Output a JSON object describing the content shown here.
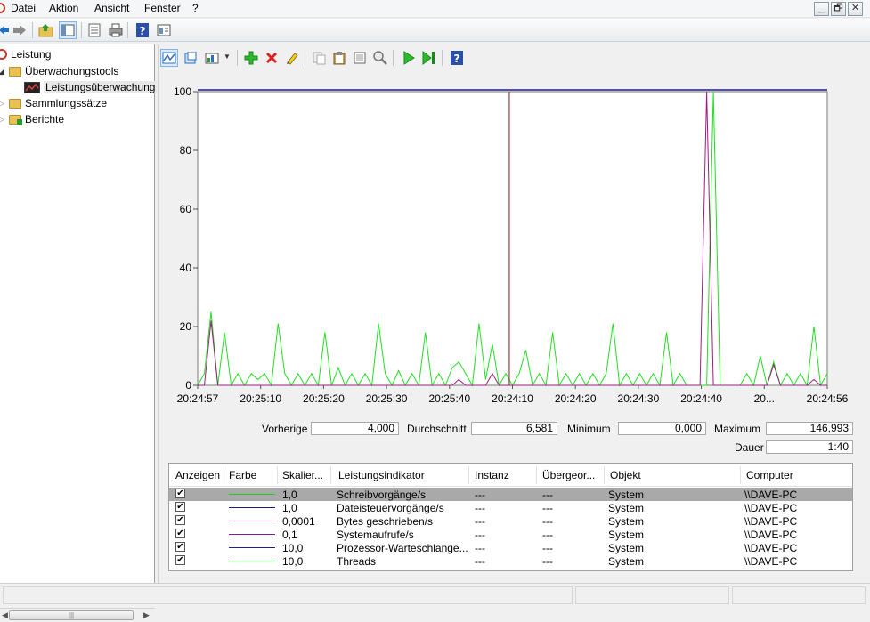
{
  "menu": [
    "Datei",
    "Aktion",
    "Ansicht",
    "Fenster",
    "?"
  ],
  "window_buttons": {
    "minimize": "_",
    "restore": "🗗",
    "close": "✕"
  },
  "tree": {
    "items": [
      {
        "label": "Leistung"
      },
      {
        "label": "Überwachungstools"
      },
      {
        "label": "Leistungsüberwachung"
      },
      {
        "label": "Sammlungssätze"
      },
      {
        "label": "Berichte"
      }
    ],
    "scroll_thumb": "|||"
  },
  "chart_data": {
    "type": "line",
    "ylim": [
      0,
      100
    ],
    "y_ticks": [
      "100",
      "80",
      "60",
      "40",
      "20",
      "0"
    ],
    "x_ticks": [
      "20:24:57",
      "20:25:10",
      "20:25:20",
      "20:25:30",
      "20:25:40",
      "20:24:10",
      "20:24:20",
      "20:24:30",
      "20:24:40",
      "20...",
      "20:24:56"
    ],
    "series": [
      {
        "name": "Schreibvorgänge/s",
        "color": "#22dd22",
        "values": [
          0,
          4,
          25,
          0,
          18,
          0,
          4,
          0,
          4,
          2,
          4,
          0,
          21,
          4,
          0,
          4,
          0,
          4,
          0,
          18,
          0,
          6,
          0,
          4,
          0,
          4,
          0,
          21,
          4,
          0,
          5,
          0,
          4,
          0,
          18,
          0,
          4,
          0,
          6,
          8,
          4,
          0,
          21,
          2,
          14,
          0,
          4,
          0,
          4,
          12,
          0,
          4,
          0,
          18,
          0,
          4,
          0,
          4,
          0,
          4,
          0,
          4,
          21,
          0,
          4,
          0,
          4,
          0,
          4,
          0,
          18,
          0,
          4,
          0,
          0,
          0,
          0,
          100,
          0,
          0,
          0,
          0,
          4,
          0,
          10,
          0,
          8,
          0,
          4,
          0,
          4,
          0,
          20,
          0,
          4
        ]
      },
      {
        "name": "Systemaufrufe/s",
        "color": "#9b1e7c",
        "values": [
          0,
          0,
          22,
          0,
          0,
          0,
          0,
          0,
          0,
          0,
          0,
          0,
          0,
          0,
          0,
          0,
          0,
          0,
          0,
          0,
          0,
          0,
          0,
          0,
          0,
          0,
          0,
          0,
          0,
          0,
          0,
          0,
          0,
          0,
          0,
          0,
          0,
          0,
          0,
          2,
          0,
          0,
          0,
          0,
          4,
          0,
          0,
          0,
          0,
          0,
          0,
          0,
          0,
          0,
          0,
          0,
          0,
          0,
          0,
          0,
          0,
          0,
          0,
          0,
          0,
          0,
          0,
          0,
          0,
          0,
          0,
          0,
          0,
          0,
          0,
          0,
          100,
          0,
          0,
          0,
          0,
          0,
          0,
          0,
          0,
          0,
          7,
          0,
          0,
          0,
          0,
          0,
          2,
          0,
          0
        ]
      },
      {
        "name": "Prozessor-Warteschlange",
        "color": "#1e1e8c",
        "values": [
          101,
          101,
          101,
          101,
          101,
          101,
          101,
          101,
          101,
          101,
          101,
          101,
          101,
          101,
          101,
          101,
          101,
          101,
          101,
          101,
          101,
          101,
          101,
          101,
          101,
          101,
          101,
          101,
          101,
          101,
          101,
          101,
          101,
          101,
          101,
          101,
          101,
          101,
          101,
          101,
          101,
          101,
          101,
          101,
          101,
          101,
          101,
          101,
          101,
          101,
          101,
          101,
          101,
          101,
          101,
          101,
          101,
          101,
          101,
          101,
          101,
          101,
          101,
          101,
          101,
          101,
          101,
          101,
          101,
          101,
          101,
          101,
          101,
          101,
          101,
          101,
          101,
          101,
          101,
          101,
          101,
          101,
          101,
          101,
          101,
          101,
          101,
          101,
          101,
          101,
          101,
          101,
          101,
          101,
          101
        ]
      }
    ],
    "cursor_line_color": "#8b1a1a",
    "cursor_position_fraction": 0.495
  },
  "stats": {
    "previous_label": "Vorherige",
    "previous_value": "4,000",
    "average_label": "Durchschnitt",
    "average_value": "6,581",
    "minimum_label": "Minimum",
    "minimum_value": "0,000",
    "maximum_label": "Maximum",
    "maximum_value": "146,993",
    "duration_label": "Dauer",
    "duration_value": "1:40"
  },
  "counter_table": {
    "headers": [
      "Anzeigen",
      "Farbe",
      "Skalier...",
      "Leistungsindikator",
      "Instanz",
      "Übergeor...",
      "Objekt",
      "Computer"
    ],
    "rows": [
      {
        "checked": "✔",
        "color": "#22cc22",
        "scale": "1,0",
        "counter": "Schreibvorgänge/s",
        "instance": "---",
        "parent": "---",
        "object": "System",
        "computer": "\\\\DAVE-PC",
        "selected": true
      },
      {
        "checked": "✔",
        "color": "#1e1e8c",
        "scale": "1,0",
        "counter": "Dateisteuervorgänge/s",
        "instance": "---",
        "parent": "---",
        "object": "System",
        "computer": "\\\\DAVE-PC",
        "selected": false
      },
      {
        "checked": "✔",
        "color": "#e080c0",
        "scale": "0,0001",
        "counter": "Bytes geschrieben/s",
        "instance": "---",
        "parent": "---",
        "object": "System",
        "computer": "\\\\DAVE-PC",
        "selected": false
      },
      {
        "checked": "✔",
        "color": "#7a1e9c",
        "scale": "0,1",
        "counter": "Systemaufrufe/s",
        "instance": "---",
        "parent": "---",
        "object": "System",
        "computer": "\\\\DAVE-PC",
        "selected": false
      },
      {
        "checked": "✔",
        "color": "#1e1e8c",
        "scale": "10,0",
        "counter": "Prozessor-Warteschlange...",
        "instance": "---",
        "parent": "---",
        "object": "System",
        "computer": "\\\\DAVE-PC",
        "selected": false
      },
      {
        "checked": "✔",
        "color": "#22cc22",
        "scale": "10,0",
        "counter": "Threads",
        "instance": "---",
        "parent": "---",
        "object": "System",
        "computer": "\\\\DAVE-PC",
        "selected": false
      }
    ]
  }
}
